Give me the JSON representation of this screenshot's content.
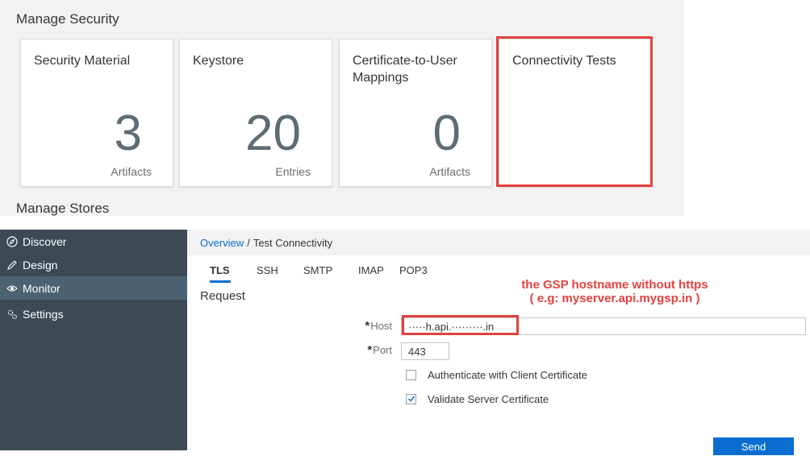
{
  "manage_security": {
    "title": "Manage Security",
    "tiles": [
      {
        "title": "Security Material",
        "number": "3",
        "unit": "Artifacts"
      },
      {
        "title": "Keystore",
        "number": "20",
        "unit": "Entries"
      },
      {
        "title": "Certificate-to-User Mappings",
        "number": "0",
        "unit": "Artifacts"
      },
      {
        "title": "Connectivity Tests",
        "number": "",
        "unit": ""
      }
    ]
  },
  "manage_stores": {
    "title": "Manage Stores"
  },
  "sidebar": {
    "items": [
      {
        "label": "Discover",
        "icon": "compass-icon"
      },
      {
        "label": "Design",
        "icon": "pencil-icon"
      },
      {
        "label": "Monitor",
        "icon": "eye-icon",
        "active": true
      },
      {
        "label": "Settings",
        "icon": "gears-icon"
      }
    ]
  },
  "breadcrumb": {
    "link": "Overview",
    "separator": "/",
    "current": "Test Connectivity"
  },
  "tabs": [
    "TLS",
    "SSH",
    "SMTP",
    "IMAP",
    "POP3"
  ],
  "active_tab": "TLS",
  "request": {
    "title": "Request",
    "host": {
      "required_mark": "*",
      "label": "Host",
      "value": "·····h.api.·········.in"
    },
    "port": {
      "required_mark": "*",
      "label": "Port",
      "value": "443"
    },
    "options": [
      {
        "label": "Authenticate with Client Certificate",
        "checked": false
      },
      {
        "label": "Validate Server Certificate",
        "checked": true
      }
    ]
  },
  "annotation": {
    "line1": "the GSP hostname without https",
    "line2": "( e.g: myserver.api.mygsp.in )"
  },
  "send_label": "Send",
  "colors": {
    "accent": "#0a6ed1",
    "highlight": "#e3413f",
    "sidebar": "#3b4a55",
    "sidebar_active": "#4b6272"
  }
}
